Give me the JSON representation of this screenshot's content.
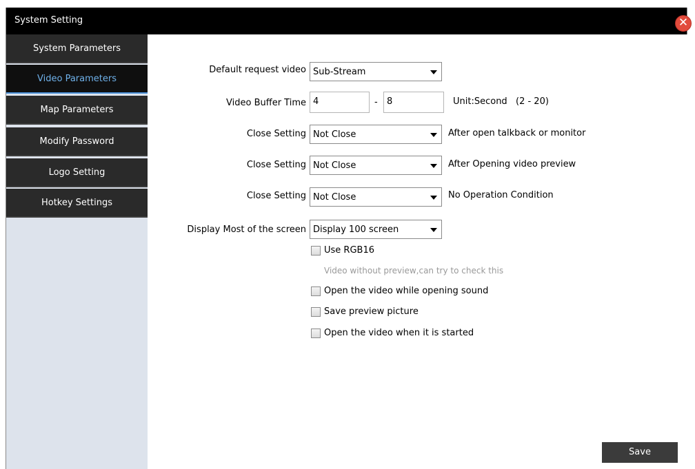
{
  "window": {
    "title": "System Setting",
    "close_glyph": "✕"
  },
  "sidebar": {
    "items": [
      {
        "label": "System Parameters"
      },
      {
        "label": "Video Parameters",
        "active": true
      },
      {
        "label": "Map Parameters"
      },
      {
        "label": "Modify Password"
      },
      {
        "label": "Logo Setting"
      },
      {
        "label": "Hotkey Settings"
      }
    ]
  },
  "form": {
    "default_request": {
      "label": "Default request video",
      "value": "Sub-Stream"
    },
    "buffer": {
      "label": "Video Buffer Time",
      "min": "4",
      "separator": "-",
      "max": "8",
      "unit": "Unit:Second",
      "range": "(2 - 20)"
    },
    "close_settings": [
      {
        "label": "Close Setting",
        "value": "Not Close",
        "note": "After open talkback or monitor"
      },
      {
        "label": "Close Setting",
        "value": "Not Close",
        "note": "After Opening video preview"
      },
      {
        "label": "Close Setting",
        "value": "Not Close",
        "note": "No Operation Condition"
      }
    ],
    "display_most": {
      "label": "Display Most of the screen",
      "value": "Display 100 screen"
    },
    "use_rgb16": {
      "label": "Use RGB16",
      "checked": false
    },
    "rgb16_hint": "Video without preview,can try to check this",
    "checkboxes": [
      {
        "label": "Open the video while opening sound",
        "checked": false
      },
      {
        "label": "Save preview picture",
        "checked": false
      },
      {
        "label": "Open the video when it is started",
        "checked": false
      }
    ]
  },
  "buttons": {
    "save": "Save"
  },
  "colors": {
    "titlebar": "#000000",
    "sidebar_item": "#2a2a2a",
    "sidebar_active_text": "#6fb1ea",
    "sidebar_bg": "#dde3ec",
    "close_button": "#e24b3c",
    "save_button": "#3b3b3b"
  }
}
